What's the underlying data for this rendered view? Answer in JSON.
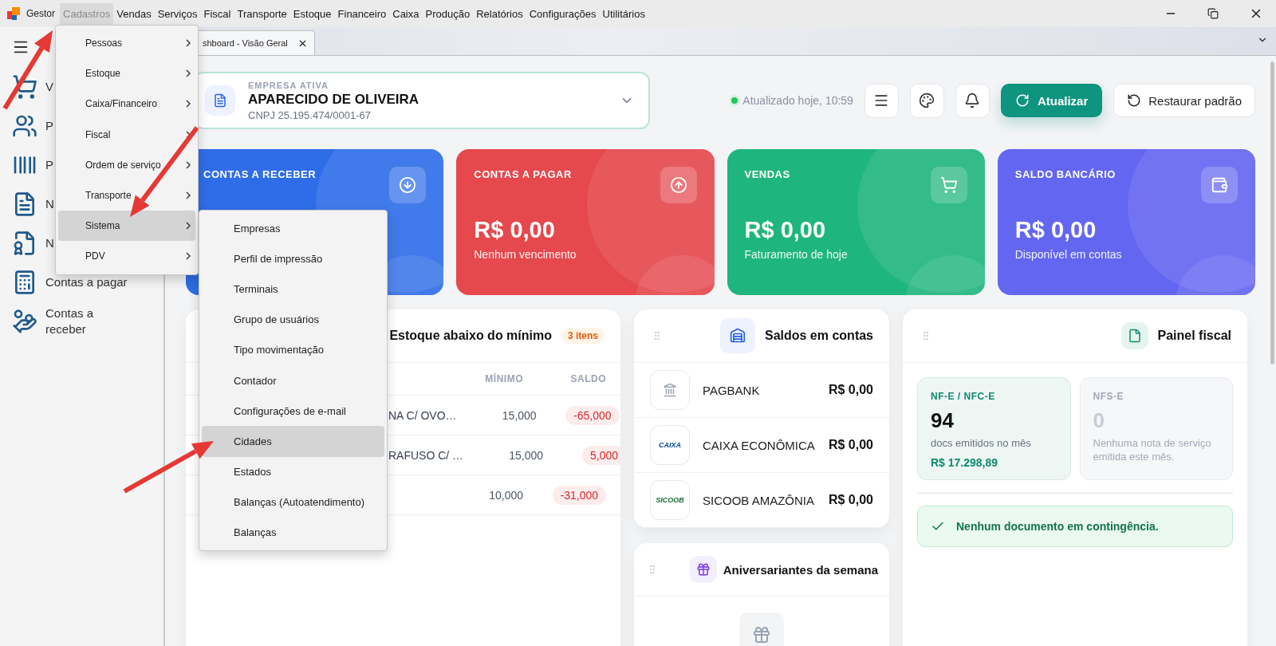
{
  "menu_bar": {
    "app_name": "Gestor",
    "items": [
      {
        "label": "Cadastros",
        "selected": true
      },
      {
        "label": "Vendas",
        "selected": false
      },
      {
        "label": "Serviços",
        "selected": false
      },
      {
        "label": "Fiscal",
        "selected": false
      },
      {
        "label": "Transporte",
        "selected": false
      },
      {
        "label": "Estoque",
        "selected": false
      },
      {
        "label": "Financeiro",
        "selected": false
      },
      {
        "label": "Caixa",
        "selected": false
      },
      {
        "label": "Produção",
        "selected": false
      },
      {
        "label": "Relatórios",
        "selected": false
      },
      {
        "label": "Configurações",
        "selected": false
      },
      {
        "label": "Utilitários",
        "selected": false
      }
    ]
  },
  "cadastros_menu": [
    {
      "label": "Pessoas",
      "selected": false
    },
    {
      "label": "Estoque",
      "selected": false
    },
    {
      "label": "Caixa/Financeiro",
      "selected": false
    },
    {
      "label": "Fiscal",
      "selected": false
    },
    {
      "label": "Ordem de serviço",
      "selected": false
    },
    {
      "label": "Transporte",
      "selected": false
    },
    {
      "label": "Sistema",
      "selected": true
    },
    {
      "label": "PDV",
      "selected": false
    }
  ],
  "sistema_submenu": [
    {
      "label": "Empresas",
      "selected": false
    },
    {
      "label": "Perfil de impressão",
      "selected": false
    },
    {
      "label": "Terminais",
      "selected": false
    },
    {
      "label": "Grupo de usuários",
      "selected": false
    },
    {
      "label": "Tipo movimentação",
      "selected": false
    },
    {
      "label": "Contador",
      "selected": false
    },
    {
      "label": "Configurações de e-mail",
      "selected": false
    },
    {
      "label": "Cidades",
      "selected": true
    },
    {
      "label": "Estados",
      "selected": false
    },
    {
      "label": "Balanças (Autoatendimento)",
      "selected": false
    },
    {
      "label": "Balanças",
      "selected": false
    }
  ],
  "sidebar": {
    "items": [
      {
        "label": "V"
      },
      {
        "label": "P"
      },
      {
        "label": "P"
      },
      {
        "label": "N"
      },
      {
        "label": "N"
      },
      {
        "label": "Contas a pagar"
      },
      {
        "label": "Contas a receber"
      }
    ]
  },
  "tabs": [
    {
      "label": "shboard - Visão Geral",
      "selected": true
    }
  ],
  "company": {
    "caption": "EMPRESA ATIVA",
    "name": "APARECIDO DE OLIVEIRA",
    "cnpj": "CNPJ 25.195.474/0001-67"
  },
  "status": {
    "text": "Atualizado hoje, 10:59",
    "online": true
  },
  "actions": {
    "refresh": "Atualizar",
    "restore": "Restaurar padrão"
  },
  "stat_cards": [
    {
      "title": "CONTAS A RECEBER",
      "color": "#2f6de8"
    },
    {
      "title": "CONTAS A PAGAR",
      "value": "R$ 0,00",
      "caption": "Nenhum vencimento",
      "color": "#e5484d"
    },
    {
      "title": "VENDAS",
      "value": "R$ 0,00",
      "caption": "Faturamento de hoje",
      "color": "#1fb57f"
    },
    {
      "title": "SALDO BANCÁRIO",
      "value": "R$ 0,00",
      "caption": "Disponível em contas",
      "color": "#6366f1"
    }
  ],
  "stock": {
    "title": "Estoque abaixo do mínimo",
    "badge": "3 itens",
    "columns": [
      "MÍNIMO",
      "SALDO"
    ],
    "rows": [
      {
        "column_1": "NA C/ OVO…",
        "minimo": "15,000",
        "saldo": "-65,000"
      },
      {
        "column_1": "RAFUSO C/ …",
        "minimo": "15,000",
        "saldo": "5,000"
      },
      {
        "minimo": "10,000",
        "saldo": "-31,000"
      }
    ]
  },
  "accounts": {
    "title": "Saldos em contas",
    "items": [
      {
        "name": "PAGBANK",
        "balance": "R$ 0,00"
      },
      {
        "name": "CAIXA ECONÔMICA",
        "balance": "R$ 0,00",
        "logo_text": "CAIXA"
      },
      {
        "name": "SICOOB AMAZÔNIA",
        "balance": "R$ 0,00",
        "logo_text": "SICOOB"
      }
    ]
  },
  "birthdays": {
    "title": "Aniversariantes da semana"
  },
  "fiscal": {
    "title": "Painel fiscal",
    "boxes": [
      {
        "label": "NF-E / NFC-E",
        "count": "94",
        "caption": "docs emitidos no mês",
        "amount": "R$ 17.298,89",
        "muted": false
      },
      {
        "label": "NFS-E",
        "count": "0",
        "caption": "Nenhuma nota de serviço emitida este mês.",
        "muted": true
      }
    ],
    "notice": "Nenhum documento em contingência."
  }
}
